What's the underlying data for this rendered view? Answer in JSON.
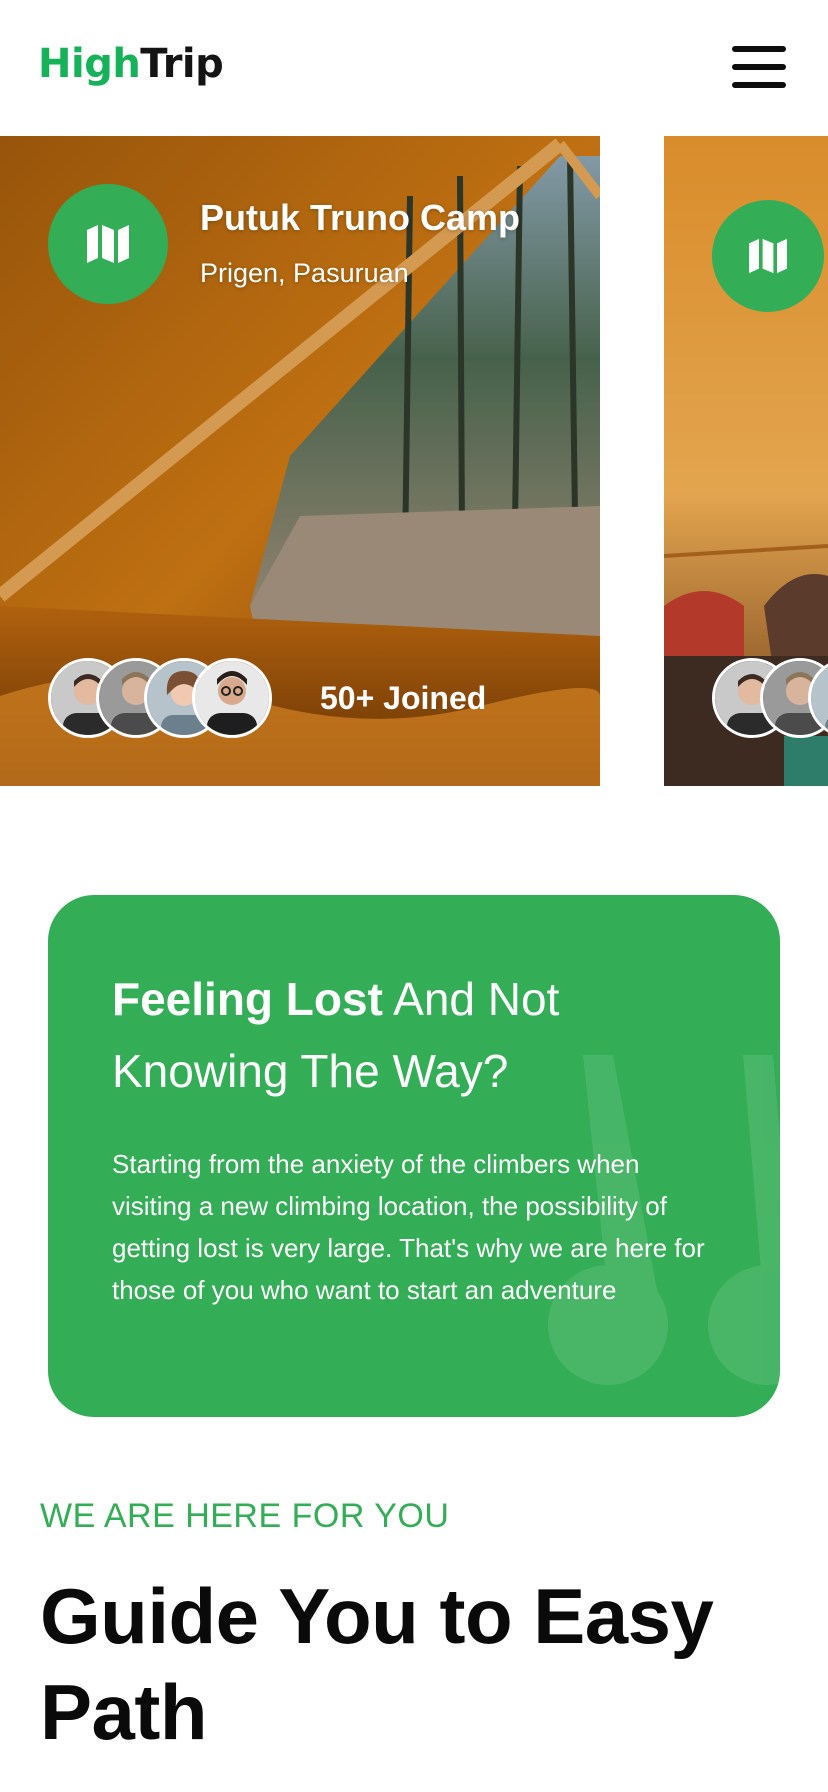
{
  "header": {
    "logo_part1": "High",
    "logo_part2": "Trip",
    "menu_icon": "hamburger-menu-icon"
  },
  "cards": [
    {
      "title": "Putuk Truno Camp",
      "location": "Prigen, Pasuruan",
      "joined": "50+ Joined",
      "icon": "map-icon"
    },
    {
      "icon": "map-icon"
    }
  ],
  "intro": {
    "title_bold": "Feeling Lost",
    "title_rest": " And Not Knowing The Way?",
    "body": "Starting from the anxiety of the climbers when visiting a new climbing location, the possibility of getting lost is very large. That's why we are here for those of you who want to start an adventure"
  },
  "section": {
    "eyebrow": "WE ARE HERE FOR YOU",
    "heading": "Guide You to Easy Path"
  },
  "colors": {
    "brand_green": "#33ad56",
    "logo_green": "#16b25a",
    "text_dark": "#0a0a0a"
  }
}
